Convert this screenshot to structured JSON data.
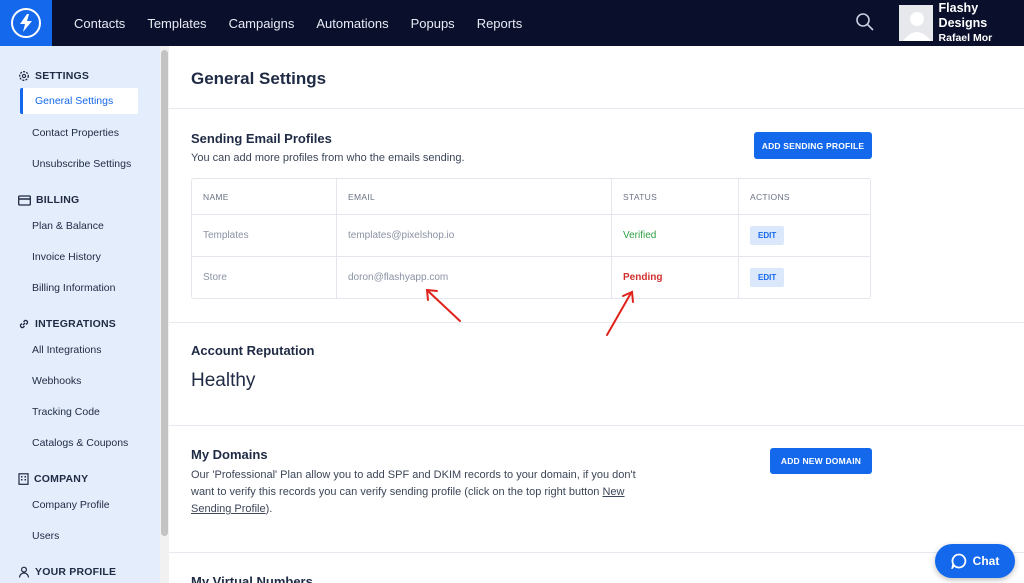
{
  "topbar": {
    "nav": [
      "Contacts",
      "Templates",
      "Campaigns",
      "Automations",
      "Popups",
      "Reports"
    ],
    "account_name": "Flashy Designs",
    "account_user": "Rafael Mor",
    "logo_icon": "lightning-bolt-icon",
    "search_icon": "search-icon"
  },
  "sidebar": {
    "settings": {
      "title": "SETTINGS",
      "items": [
        "General Settings",
        "Contact Properties",
        "Unsubscribe Settings"
      ]
    },
    "billing": {
      "title": "BILLING",
      "items": [
        "Plan & Balance",
        "Invoice History",
        "Billing Information"
      ]
    },
    "integrations": {
      "title": "INTEGRATIONS",
      "items": [
        "All Integrations",
        "Webhooks",
        "Tracking Code",
        "Catalogs & Coupons"
      ]
    },
    "company": {
      "title": "COMPANY",
      "items": [
        "Company Profile",
        "Users"
      ]
    },
    "profile": {
      "title": "YOUR PROFILE"
    }
  },
  "main": {
    "title": "General Settings",
    "sending": {
      "title": "Sending Email Profiles",
      "description": "You can add more profiles from who the emails sending.",
      "button": "ADD SENDING PROFILE",
      "table": {
        "headers": [
          "NAME",
          "EMAIL",
          "STATUS",
          "ACTIONS"
        ],
        "rows": [
          {
            "name": "Templates",
            "email": "templates@pixelshop.io",
            "status": "Verified",
            "action": "EDIT"
          },
          {
            "name": "Store",
            "email": "doron@flashyapp.com",
            "status": "Pending",
            "action": "EDIT"
          }
        ]
      }
    },
    "reputation": {
      "title": "Account Reputation",
      "value": "Healthy"
    },
    "domains": {
      "title": "My Domains",
      "button": "ADD NEW DOMAIN",
      "desc_line1": "Our 'Professional' Plan allow you to add SPF and DKIM records to your domain, if you don't",
      "desc_line2_pre": "want to verify this records you can verify sending profile (click on the top right button ",
      "desc_link_a": "New",
      "desc_link_b": "Sending Profile",
      "desc_line3_post": ")."
    },
    "virtual_numbers": {
      "title": "My Virtual Numbers"
    }
  },
  "chat": {
    "label": "Chat"
  },
  "colors": {
    "accent": "#1468ec",
    "topbar": "#0a0f2c",
    "sidebar": "#e3edfb",
    "verified": "#2ea043",
    "pending": "#d0302d",
    "annotation": "#e0221c"
  }
}
